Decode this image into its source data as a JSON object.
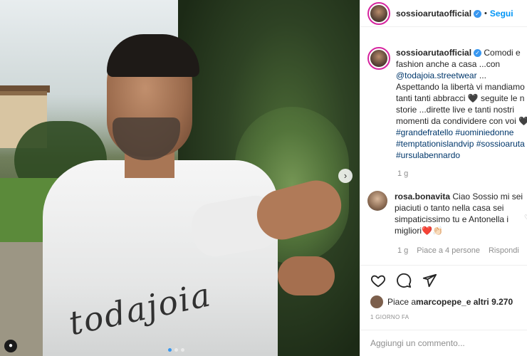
{
  "post": {
    "author": "sossioarutaofficial",
    "follow_label": "Segui",
    "separator": "•",
    "verified_mark": "✓",
    "sleeve_text": "todajoia",
    "caption": {
      "text_start": "Comodi e",
      "line2": "fashion anche a casa ...con",
      "mention": "@todajoia.streetwear",
      "mention_suffix": " ...",
      "line4": "Aspettando la libertà vi mandiamo",
      "line5": "tanti tanti abbracci 🖤 seguite le n",
      "line6": "storie ...dirette live e tanti nostri",
      "line7": "momenti da condividere con voi 🖤",
      "tags1": "#grandefratello #uominiedonne",
      "tags2": "#temptationislandvip #sossioaruta",
      "tags3": "#ursulabennardo",
      "time": "1 g"
    },
    "comment": {
      "user": "rosa.bonavita",
      "text": "Ciao Sossio mi sei piaciuti o tanto nella casa sei simpaticissimo tu e Antonella i migliori❤️👏🏻",
      "time": "1 g",
      "likes": "Piace a 4 persone",
      "reply": "Rispondi"
    },
    "likes_text_prefix": "Piace a ",
    "likes_user": "marcopepe_",
    "likes_suffix": " e altri 9.270",
    "date": "1 GIORNO FA",
    "add_comment_placeholder": "Aggiungi un commento...",
    "icons": [
      "heart-icon",
      "comment-icon",
      "share-icon"
    ],
    "accent_color": "#0095f6"
  }
}
